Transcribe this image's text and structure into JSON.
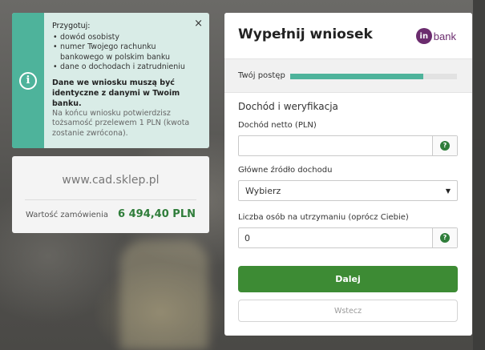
{
  "info": {
    "heading": "Przygotuj:",
    "items": [
      "dowód osobisty",
      "numer Twojego rachunku bankowego w polskim banku",
      "dane o dochodach i zatrudnieniu"
    ],
    "bold_text": "Dane we wniosku muszą być identyczne z danymi w Twoim banku.",
    "muted_text": "Na końcu wniosku potwierdzisz tożsamość przelewem 1 PLN (kwota zostanie zwrócona).",
    "close_glyph": "×",
    "icon_glyph": "i"
  },
  "store": {
    "url": "www.cad.sklep.pl",
    "label": "Wartość zamówienia",
    "amount": "6 494,40 PLN"
  },
  "form": {
    "title": "Wypełnij wniosek",
    "brand_mark": "in",
    "brand_text": "bank",
    "progress_label": "Twój postęp",
    "progress": 0.8,
    "section_title": "Dochód i weryfikacja",
    "net_income_label": "Dochód netto (PLN)",
    "net_income_value": "",
    "income_source_label": "Główne źródło dochodu",
    "income_source_value": "Wybierz",
    "dependents_label": "Liczba osób na utrzymaniu (oprócz Ciebie)",
    "dependents_value": "0",
    "help_glyph": "?",
    "select_arrow": "▼",
    "next_label": "Dalej",
    "back_label": "Wstecz"
  },
  "colors": {
    "accent": "#4eb39b",
    "primary_button": "#3d8b34",
    "amount": "#2f7d3a",
    "brand": "#6b2c6e"
  }
}
